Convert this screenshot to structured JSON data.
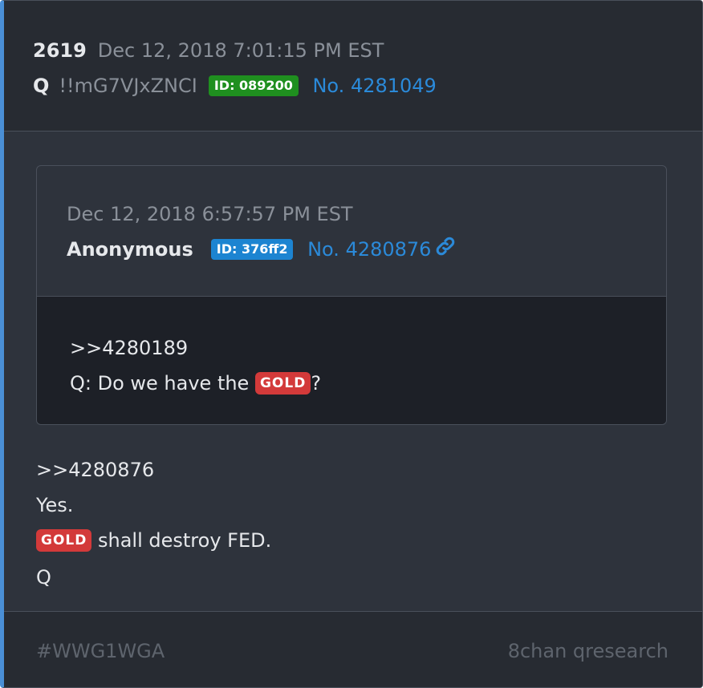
{
  "post": {
    "number": "2619",
    "timestamp": "Dec 12, 2018 7:01:15 PM EST",
    "author": "Q",
    "tripcode": "!!mG7VJxZNCI",
    "id_badge": "ID: 089200",
    "post_no": "No. 4281049"
  },
  "quoted": {
    "timestamp": "Dec 12, 2018 6:57:57 PM EST",
    "author": "Anonymous",
    "id_badge": "ID: 376ff2",
    "post_no": "No. 4280876",
    "link_icon": "link-icon",
    "line1": ">>4280189",
    "line2_before": "Q: Do we have the ",
    "line2_tag": "GOLD",
    "line2_after": "?"
  },
  "body": {
    "line1": ">>4280876",
    "line2": "Yes.",
    "line3_tag": "GOLD",
    "line3_after": " shall destroy FED.",
    "line4": "Q"
  },
  "footer": {
    "hashtag": "#WWG1WGA",
    "source": "8chan qresearch"
  },
  "colors": {
    "accent": "#4a8fd6",
    "id_green": "#1f8f1f",
    "id_blue": "#1c84d1",
    "link": "#2b8ad9",
    "tag_red": "#d33a3a"
  }
}
